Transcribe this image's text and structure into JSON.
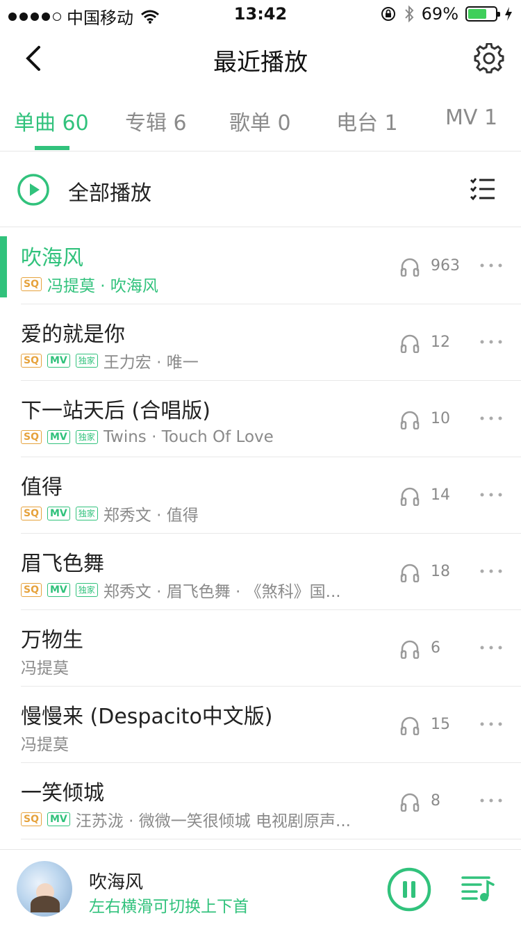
{
  "status_bar": {
    "carrier": "中国移动",
    "time": "13:42",
    "battery_percent": "69%",
    "battery_level": 0.69,
    "signal_bars_filled": 4,
    "signal_bars_total": 5
  },
  "nav": {
    "title": "最近播放",
    "back_icon": "chevron-left-icon",
    "settings_icon": "gear-icon"
  },
  "tabs": [
    {
      "label": "单曲 60",
      "active": true
    },
    {
      "label": "专辑 6",
      "active": false
    },
    {
      "label": "歌单 0",
      "active": false
    },
    {
      "label": "电台 1",
      "active": false
    },
    {
      "label": "MV 1",
      "active": false
    }
  ],
  "play_all": {
    "label": "全部播放",
    "icon": "play-circle-icon",
    "multi_select_icon": "multi-select-list-icon"
  },
  "songs": [
    {
      "title": "吹海风",
      "meta": "冯提莫 · 吹海风",
      "badges": [
        "SQ"
      ],
      "plays": "963",
      "playing": true
    },
    {
      "title": "爱的就是你",
      "meta": "王力宏 · 唯一",
      "badges": [
        "SQ",
        "MV",
        "独家"
      ],
      "plays": "12"
    },
    {
      "title": "下一站天后 (合唱版)",
      "meta": "Twins · Touch Of Love",
      "badges": [
        "SQ",
        "MV",
        "独家"
      ],
      "plays": "10"
    },
    {
      "title": "值得",
      "meta": "郑秀文 · 值得",
      "badges": [
        "SQ",
        "MV",
        "独家"
      ],
      "plays": "14"
    },
    {
      "title": "眉飞色舞",
      "meta": "郑秀文 · 眉飞色舞 · 《煞科》国...",
      "badges": [
        "SQ",
        "MV",
        "独家"
      ],
      "plays": "18"
    },
    {
      "title": "万物生",
      "meta": "冯提莫",
      "badges": [],
      "plays": "6"
    },
    {
      "title": "慢慢来 (Despacito中文版)",
      "meta": "冯提莫",
      "badges": [],
      "plays": "15"
    },
    {
      "title": "一笑倾城",
      "meta": "汪苏泷 · 微微一笑很倾城 电视剧原声...",
      "badges": [
        "SQ",
        "MV"
      ],
      "plays": "8"
    }
  ],
  "player": {
    "title": "吹海风",
    "hint": "左右横滑可切换上下首",
    "pause_icon": "pause-circle-icon",
    "playlist_icon": "playlist-icon"
  },
  "colors": {
    "accent": "#31c27c",
    "sq_badge": "#e6a23c",
    "secondary_text": "#8a8a8a"
  }
}
